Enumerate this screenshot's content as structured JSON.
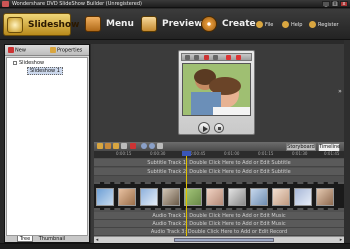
{
  "window": {
    "title": "Wondershare DVD SlideShow Builder (Unregistered)",
    "minimize_glyph": "_",
    "maximize_glyph": "□",
    "close_glyph": "x"
  },
  "toolbar": {
    "tabs": [
      {
        "label": "Slideshow",
        "icon": "slideshow-icon",
        "color": "#e5c45a"
      },
      {
        "label": "Menu",
        "icon": "menu-grid-icon",
        "color": "#c97a2b"
      },
      {
        "label": "Preview",
        "icon": "preview-tv-icon",
        "color": "#6a86c8"
      },
      {
        "label": "Create",
        "icon": "create-disc-icon",
        "color": "#d3822d"
      }
    ],
    "links": [
      {
        "label": "File",
        "icon": "file-icon"
      },
      {
        "label": "Help",
        "icon": "help-icon"
      },
      {
        "label": "Register",
        "icon": "register-icon"
      }
    ]
  },
  "left_panel": {
    "new_label": "New",
    "properties_label": "Properties",
    "tree_root": "Slideshow",
    "tree_child": "Slideshow 1",
    "tabs": [
      "Tree",
      "Thumbnail"
    ]
  },
  "preview": {
    "collapse_glyph": "»",
    "photo_description_icon": "family-photo-icon"
  },
  "timeline": {
    "tabs": [
      "Storyboard",
      "Timeline"
    ],
    "ruler_ticks": [
      "0:00:15",
      "0:00:30",
      "0:00:45",
      "0:01:00",
      "0:01:15",
      "0:01:30",
      "0:01:45"
    ],
    "subtitle_tracks": [
      "Subtitle Track 1: Double Click Here to Add or Edit Subtitle",
      "Subtitle Track 2: Double Click Here to Add or Edit Subtitle"
    ],
    "audio_tracks": [
      "Audio Track 1: Double Click Here to Add or Edit Music",
      "Audio Track 2: Double Click Here to Add or Edit Music",
      "Audio Track 3: Double Click Here to Add or Edit Record"
    ],
    "scroll_left": "◂",
    "scroll_right": "▸"
  },
  "colors": {
    "accent": "#e5c45a",
    "playhead": "#e0c000",
    "background": "#2a2a2a"
  }
}
